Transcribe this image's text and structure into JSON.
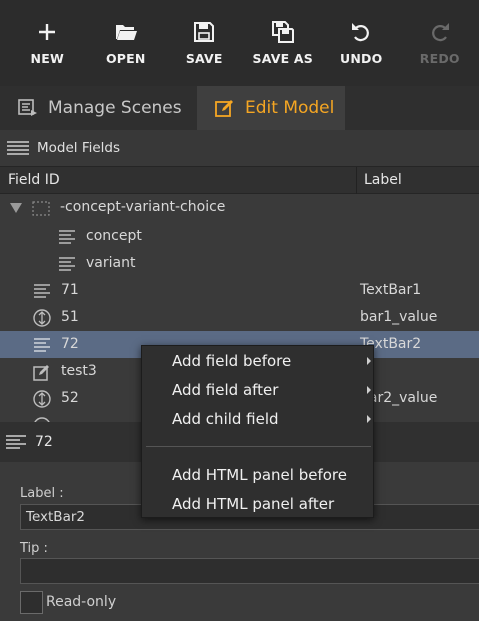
{
  "toolbar": {
    "new": "NEW",
    "open": "OPEN",
    "save": "SAVE",
    "save_as": "SAVE AS",
    "undo": "UNDO",
    "redo": "REDO"
  },
  "tabs": {
    "manage": "Manage Scenes",
    "edit": "Edit Model"
  },
  "model_fields": {
    "title": "Model Fields",
    "col_field": "Field ID",
    "col_label": "Label"
  },
  "tree": [
    {
      "name": "-concept-variant-choice",
      "label": ""
    },
    {
      "name": "concept",
      "label": ""
    },
    {
      "name": "variant",
      "label": ""
    },
    {
      "name": "71",
      "label": "TextBar1"
    },
    {
      "name": "51",
      "label": "bar1_value"
    },
    {
      "name": "72",
      "label": "TextBar2"
    },
    {
      "name": "test3",
      "label": ""
    },
    {
      "name": "52",
      "label": "bar2_value"
    }
  ],
  "details": {
    "title": "72",
    "label_caption": "Label :",
    "label_value": "TextBar2",
    "tip_caption": "Tip :",
    "tip_value": "",
    "readonly": "Read-only"
  },
  "context_menu": {
    "field_before": "Add field before",
    "field_after": "Add field after",
    "child_field": "Add child field",
    "html_before": "Add HTML panel before",
    "html_after": "Add HTML panel after"
  },
  "colors": {
    "accent": "#f5a623",
    "selection": "#5b6b85"
  }
}
